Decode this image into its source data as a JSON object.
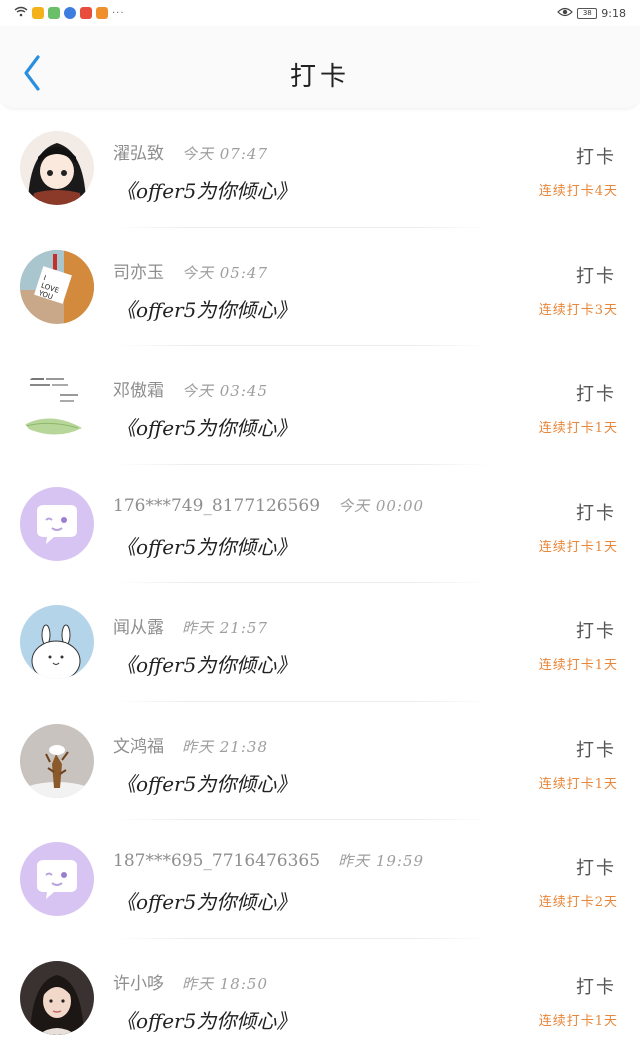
{
  "status_bar": {
    "time": "9:18",
    "battery": "38",
    "dots": "···"
  },
  "header": {
    "title": "打卡"
  },
  "colors": {
    "accent": "#2a8fde",
    "streak": "#e8873a",
    "name": "#8e8e8e"
  },
  "items": [
    {
      "name": "濯弘致",
      "time": "今天 07:47",
      "book": "《offer5为你倾心》",
      "action": "打卡",
      "streak": "连续打卡4天",
      "avatar": "anime-girl-avatar"
    },
    {
      "name": "司亦玉",
      "time": "今天 05:47",
      "book": "《offer5为你倾心》",
      "action": "打卡",
      "streak": "连续打卡3天",
      "avatar": "love-you-note-avatar"
    },
    {
      "name": "邓傲霜",
      "time": "今天 03:45",
      "book": "《offer5为你倾心》",
      "action": "打卡",
      "streak": "连续打卡1天",
      "avatar": "text-leaf-avatar"
    },
    {
      "name": "176***749_8177126569",
      "time": "今天 00:00",
      "book": "《offer5为你倾心》",
      "action": "打卡",
      "streak": "连续打卡1天",
      "avatar": "default-chat-avatar"
    },
    {
      "name": "闻从露",
      "time": "昨天 21:57",
      "book": "《offer5为你倾心》",
      "action": "打卡",
      "streak": "连续打卡1天",
      "avatar": "bunny-avatar"
    },
    {
      "name": "文鸿福",
      "time": "昨天 21:38",
      "book": "《offer5为你倾心》",
      "action": "打卡",
      "streak": "连续打卡1天",
      "avatar": "snow-plant-avatar"
    },
    {
      "name": "187***695_7716476365",
      "time": "昨天 19:59",
      "book": "《offer5为你倾心》",
      "action": "打卡",
      "streak": "连续打卡2天",
      "avatar": "default-chat-avatar"
    },
    {
      "name": "许小哆",
      "time": "昨天 18:50",
      "book": "《offer5为你倾心》",
      "action": "打卡",
      "streak": "连续打卡1天",
      "avatar": "portrait-avatar"
    }
  ]
}
